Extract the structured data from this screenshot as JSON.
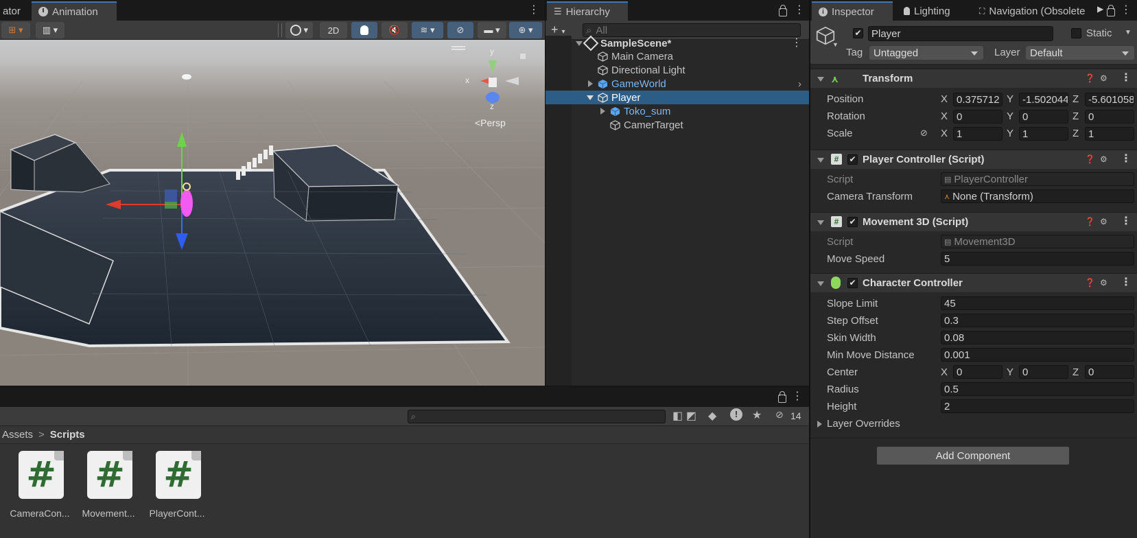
{
  "scene": {
    "tabs": [
      {
        "label": "ator"
      },
      {
        "label": "Animation"
      }
    ],
    "toolbar": {
      "mode_2d": "2D"
    },
    "gizmo": {
      "axis_y": "y",
      "axis_x": "x",
      "axis_z": "z",
      "projection": "<Persp"
    }
  },
  "hierarchy": {
    "tab": "Hierarchy",
    "search_placeholder": "All",
    "scene_name": "SampleScene*",
    "items": [
      {
        "label": "Main Camera"
      },
      {
        "label": "Directional Light"
      },
      {
        "label": "GameWorld"
      },
      {
        "label": "Player"
      },
      {
        "label": "Toko_sum"
      },
      {
        "label": "CamerTarget"
      }
    ]
  },
  "inspector": {
    "tabs": [
      {
        "label": "Inspector"
      },
      {
        "label": "Lighting"
      },
      {
        "label": "Navigation (Obsolete"
      }
    ],
    "object_name": "Player",
    "static_label": "Static",
    "tag_label": "Tag",
    "tag_value": "Untagged",
    "layer_label": "Layer",
    "layer_value": "Default",
    "transform": {
      "title": "Transform",
      "position_label": "Position",
      "rotation_label": "Rotation",
      "scale_label": "Scale",
      "position": {
        "x": "0.375712",
        "y": "-1.502044",
        "z": "-5.601058"
      },
      "rotation": {
        "x": "0",
        "y": "0",
        "z": "0"
      },
      "scale": {
        "x": "1",
        "y": "1",
        "z": "1"
      }
    },
    "player_controller": {
      "title": "Player Controller (Script)",
      "script_label": "Script",
      "script_value": "PlayerController",
      "camera_label": "Camera Transform",
      "camera_value": "None (Transform)"
    },
    "movement": {
      "title": "Movement 3D (Script)",
      "script_label": "Script",
      "script_value": "Movement3D",
      "speed_label": "Move Speed",
      "speed_value": "5"
    },
    "character_controller": {
      "title": "Character Controller",
      "slope_label": "Slope Limit",
      "slope_value": "45",
      "step_label": "Step Offset",
      "step_value": "0.3",
      "skin_label": "Skin Width",
      "skin_value": "0.08",
      "minmove_label": "Min Move Distance",
      "minmove_value": "0.001",
      "center_label": "Center",
      "center": {
        "x": "0",
        "y": "0",
        "z": "0"
      },
      "radius_label": "Radius",
      "radius_value": "0.5",
      "height_label": "Height",
      "height_value": "2",
      "layer_overrides": "Layer Overrides"
    },
    "add_component": "Add Component",
    "axis": {
      "x": "X",
      "y": "Y",
      "z": "Z"
    }
  },
  "project": {
    "breadcrumb_root": "Assets",
    "breadcrumb_sep": ">",
    "breadcrumb_current": "Scripts",
    "hidden_count": "14",
    "assets": [
      {
        "label": "CameraCon..."
      },
      {
        "label": "Movement..."
      },
      {
        "label": "PlayerCont..."
      }
    ],
    "script_glyph": "#"
  },
  "colors": {
    "accent": "#3a79bb",
    "selection": "#2c5d87",
    "prefab_blue": "#7cb8f4"
  }
}
